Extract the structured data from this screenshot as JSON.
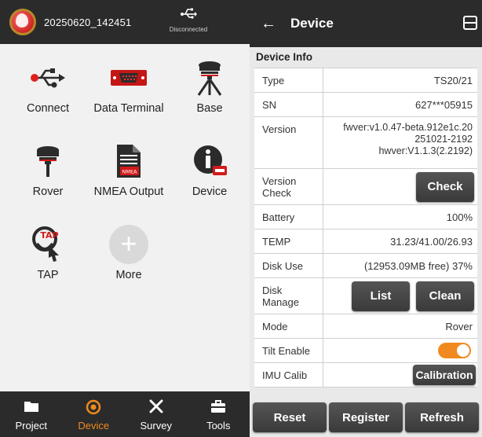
{
  "left": {
    "project_name": "20250620_142451",
    "connection_status": "Disconnected",
    "tiles": [
      {
        "label": "Connect",
        "icon": "usb-icon"
      },
      {
        "label": "Data Terminal",
        "icon": "serial-port-icon"
      },
      {
        "label": "Base",
        "icon": "base-station-icon"
      },
      {
        "label": "Rover",
        "icon": "rover-receiver-icon"
      },
      {
        "label": "NMEA Output",
        "icon": "nmea-file-icon"
      },
      {
        "label": "Device",
        "icon": "device-info-icon"
      },
      {
        "label": "TAP",
        "icon": "tap-icon"
      },
      {
        "label": "More",
        "icon": "plus-icon"
      }
    ],
    "nav": [
      {
        "label": "Project",
        "icon": "folder-icon"
      },
      {
        "label": "Device",
        "icon": "target-icon"
      },
      {
        "label": "Survey",
        "icon": "tools-cross-icon"
      },
      {
        "label": "Tools",
        "icon": "toolbox-icon"
      }
    ],
    "active_nav": "Device",
    "accent_color": "#f08a1e"
  },
  "right": {
    "title": "Device",
    "section": "Device Info",
    "rows": {
      "type": {
        "k": "Type",
        "v": "TS20/21"
      },
      "sn": {
        "k": "SN",
        "v": "627***05915"
      },
      "version": {
        "k": "Version",
        "v1": "fwver:v1.0.47-beta.912e1c.20",
        "v2": "251021-2192",
        "v3": "hwver:V1.1.3(2.2192)"
      },
      "version_check": {
        "k1": "Version",
        "k2": "Check",
        "btn": "Check"
      },
      "battery": {
        "k": "Battery",
        "v": "100%"
      },
      "temp": {
        "k": "TEMP",
        "v": "31.23/41.00/26.93"
      },
      "disk_use": {
        "k": "Disk Use",
        "v": "(12953.09MB free) 37%"
      },
      "disk_manage": {
        "k1": "Disk",
        "k2": "Manage",
        "btn_list": "List",
        "btn_clean": "Clean"
      },
      "mode": {
        "k": "Mode",
        "v": "Rover"
      },
      "tilt": {
        "k": "Tilt Enable",
        "on": true
      },
      "imu": {
        "k": "IMU Calib",
        "btn": "Calibration"
      }
    },
    "bottom_buttons": [
      "Reset",
      "Register",
      "Refresh"
    ]
  }
}
